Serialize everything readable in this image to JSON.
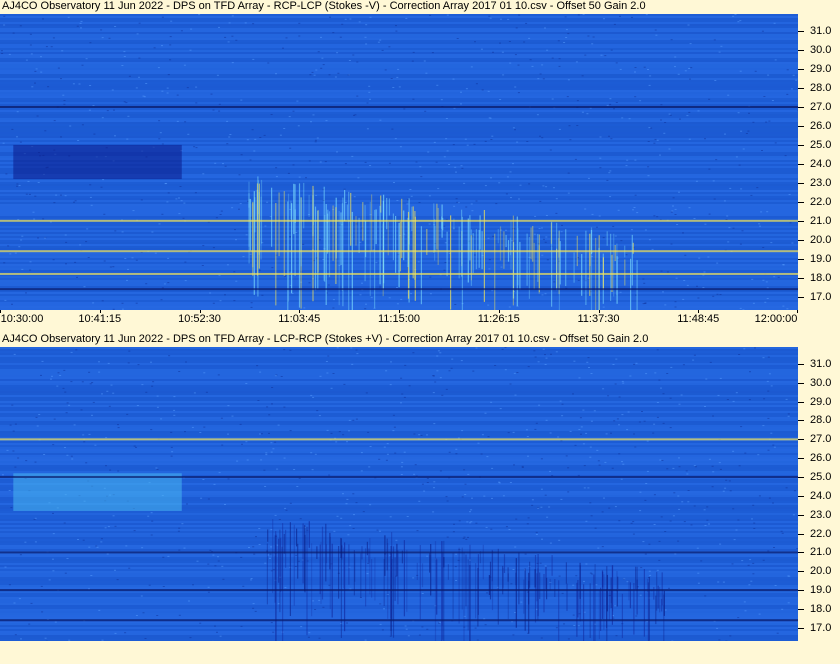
{
  "colors": {
    "background": "#fff8d6",
    "spectrogram_base": "#1e5fd8",
    "dark_band": "#0b1a8a",
    "bright_burst": "#7ee0ff",
    "hot_line": "#f2e45a"
  },
  "chart_data": [
    {
      "type": "heatmap",
      "title": "AJ4CO Observatory 11 Jun 2022  -  DPS on TFD Array  -  RCP-LCP (Stokes -V)  -  Correction Array 2017 01 10.csv  -  Offset 50  Gain 2.0",
      "xlabel": "",
      "ylabel": "",
      "x_ticks": [
        "10:30:00",
        "10:41:15",
        "10:52:30",
        "11:03:45",
        "11:15:00",
        "11:26:15",
        "11:37:30",
        "11:48:45",
        "12:00:00"
      ],
      "xlim": [
        "10:30:00",
        "12:00:00"
      ],
      "y_ticks": [
        31.0,
        30.0,
        29.0,
        28.0,
        27.0,
        26.0,
        25.0,
        24.0,
        23.0,
        22.0,
        21.0,
        20.0,
        19.0,
        18.0,
        17.0
      ],
      "y_tick_labels": [
        "31.0",
        "30.0",
        "29.0",
        "28.0",
        "27.0",
        "26.0",
        "25.0",
        "24.0",
        "23.0",
        "22.0",
        "21.0",
        "20.0",
        "19.0",
        "18.0",
        "17.0"
      ],
      "ylim": [
        16.3,
        31.9
      ],
      "polarity": "dark",
      "features": [
        {
          "kind": "block",
          "t_start": "10:31:30",
          "t_end": "10:50:30",
          "f_low": 23.2,
          "f_high": 25.0
        },
        {
          "kind": "burst",
          "t_start": "10:58:00",
          "t_end": "11:42:00",
          "f_low": 16.5,
          "f_high": 23.5
        },
        {
          "kind": "line",
          "freq": 27.0
        },
        {
          "kind": "line",
          "freq": 21.0
        },
        {
          "kind": "line",
          "freq": 19.4
        },
        {
          "kind": "line",
          "freq": 18.2
        },
        {
          "kind": "line",
          "freq": 17.4
        }
      ]
    },
    {
      "type": "heatmap",
      "title": "AJ4CO Observatory 11 Jun 2022  -  DPS on TFD Array  -  LCP-RCP (Stokes +V)  -  Correction Array 2017 01 10.csv  -  Offset 50  Gain 2.0",
      "xlabel": "",
      "ylabel": "",
      "x_ticks": [],
      "xlim": [
        "10:30:00",
        "12:00:00"
      ],
      "y_ticks": [
        31.0,
        30.0,
        29.0,
        28.0,
        27.0,
        26.0,
        25.0,
        24.0,
        23.0,
        22.0,
        21.0,
        20.0,
        19.0,
        18.0,
        17.0
      ],
      "y_tick_labels": [
        "31.0",
        "30.0",
        "29.0",
        "28.0",
        "27.0",
        "26.0",
        "25.0",
        "24.0",
        "23.0",
        "22.0",
        "21.0",
        "20.0",
        "19.0",
        "18.0",
        "17.0"
      ],
      "ylim": [
        16.3,
        31.9
      ],
      "polarity": "bright",
      "features": [
        {
          "kind": "block",
          "t_start": "10:31:30",
          "t_end": "10:50:30",
          "f_low": 23.2,
          "f_high": 25.2
        },
        {
          "kind": "burst",
          "t_start": "11:00:00",
          "t_end": "11:45:00",
          "f_low": 16.5,
          "f_high": 23.0
        },
        {
          "kind": "line",
          "freq": 27.0
        },
        {
          "kind": "line",
          "freq": 25.0
        },
        {
          "kind": "line",
          "freq": 21.0
        },
        {
          "kind": "line",
          "freq": 19.0
        },
        {
          "kind": "line",
          "freq": 17.4
        }
      ]
    }
  ]
}
